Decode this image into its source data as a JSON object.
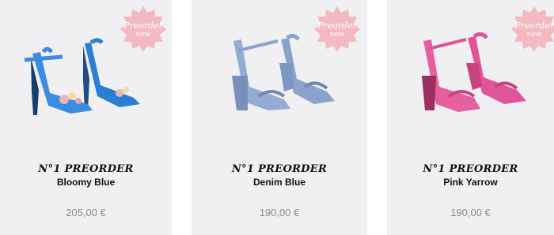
{
  "products": [
    {
      "collection": "N°1 PREORDER",
      "name": "Bloomy Blue",
      "price": "205,00 €",
      "badge": {
        "line1": "Preorder",
        "line2": "now"
      },
      "color": "#2b7fd3"
    },
    {
      "collection": "N°1 PREORDER",
      "name": "Denim Blue",
      "price": "190,00 €",
      "badge": {
        "line1": "Preorder",
        "line2": "now"
      },
      "color": "#8aa3cc"
    },
    {
      "collection": "N°1 PREORDER",
      "name": "Pink Yarrow",
      "price": "190,00 €",
      "badge": {
        "line1": "Preorder",
        "line2": "now"
      },
      "color": "#e0559a"
    }
  ],
  "colors": {
    "badge": "#f3b9bf",
    "card_bg": "#f0f0f2",
    "price": "#8a8a8a"
  }
}
